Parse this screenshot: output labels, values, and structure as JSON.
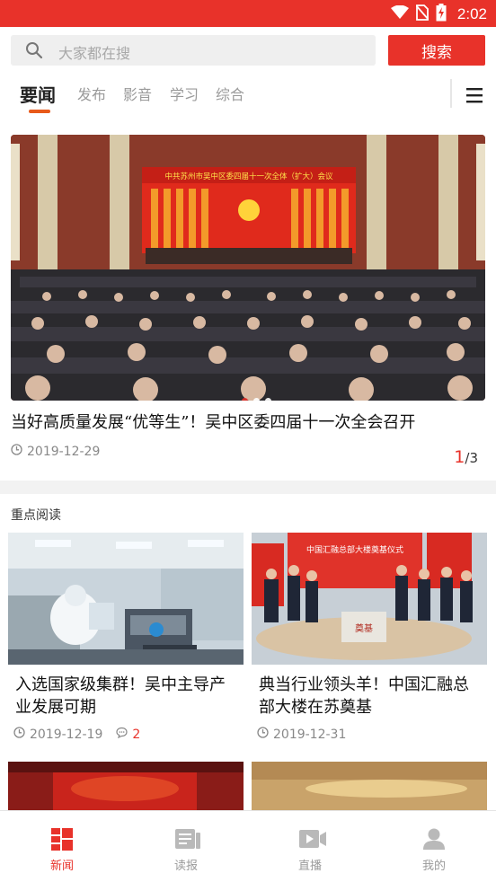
{
  "status_bar": {
    "time": "2:02",
    "color": "#e8322a"
  },
  "search": {
    "placeholder": "大家都在搜",
    "button_label": "搜索"
  },
  "tabs": [
    {
      "label": "要闻",
      "active": true
    },
    {
      "label": "发布",
      "active": false
    },
    {
      "label": "影音",
      "active": false
    },
    {
      "label": "学习",
      "active": false
    },
    {
      "label": "综合",
      "active": false
    }
  ],
  "banner": {
    "stage_banner": "中共苏州市吴中区委四届十一次全体（扩大）会议",
    "title": "当好高质量发展“优等生”！吴中区委四届十一次全会召开",
    "date": "2019-12-29",
    "current": "1",
    "total": "/3",
    "slides": 3,
    "active_slide": 1
  },
  "featured": {
    "title": "重点阅读",
    "cards": [
      {
        "title": "入选国家级集群！吴中主导产业发展可期",
        "date": "2019-12-19",
        "comments": "2"
      },
      {
        "title": "典当行业领头羊！中国汇融总部大楼在苏奠基",
        "date": "2019-12-31",
        "comments": "",
        "sign_text": "中国汇融总部大楼奠基仪式",
        "stone_text": "奠基"
      }
    ]
  },
  "bottom_nav": [
    {
      "label": "新闻",
      "icon": "news-grid-icon",
      "active": true
    },
    {
      "label": "读报",
      "icon": "newspaper-icon",
      "active": false
    },
    {
      "label": "直播",
      "icon": "video-camera-icon",
      "active": false
    },
    {
      "label": "我的",
      "icon": "person-icon",
      "active": false
    }
  ],
  "colors": {
    "accent": "#e8322a",
    "tab_underline": "#e85a1a"
  }
}
